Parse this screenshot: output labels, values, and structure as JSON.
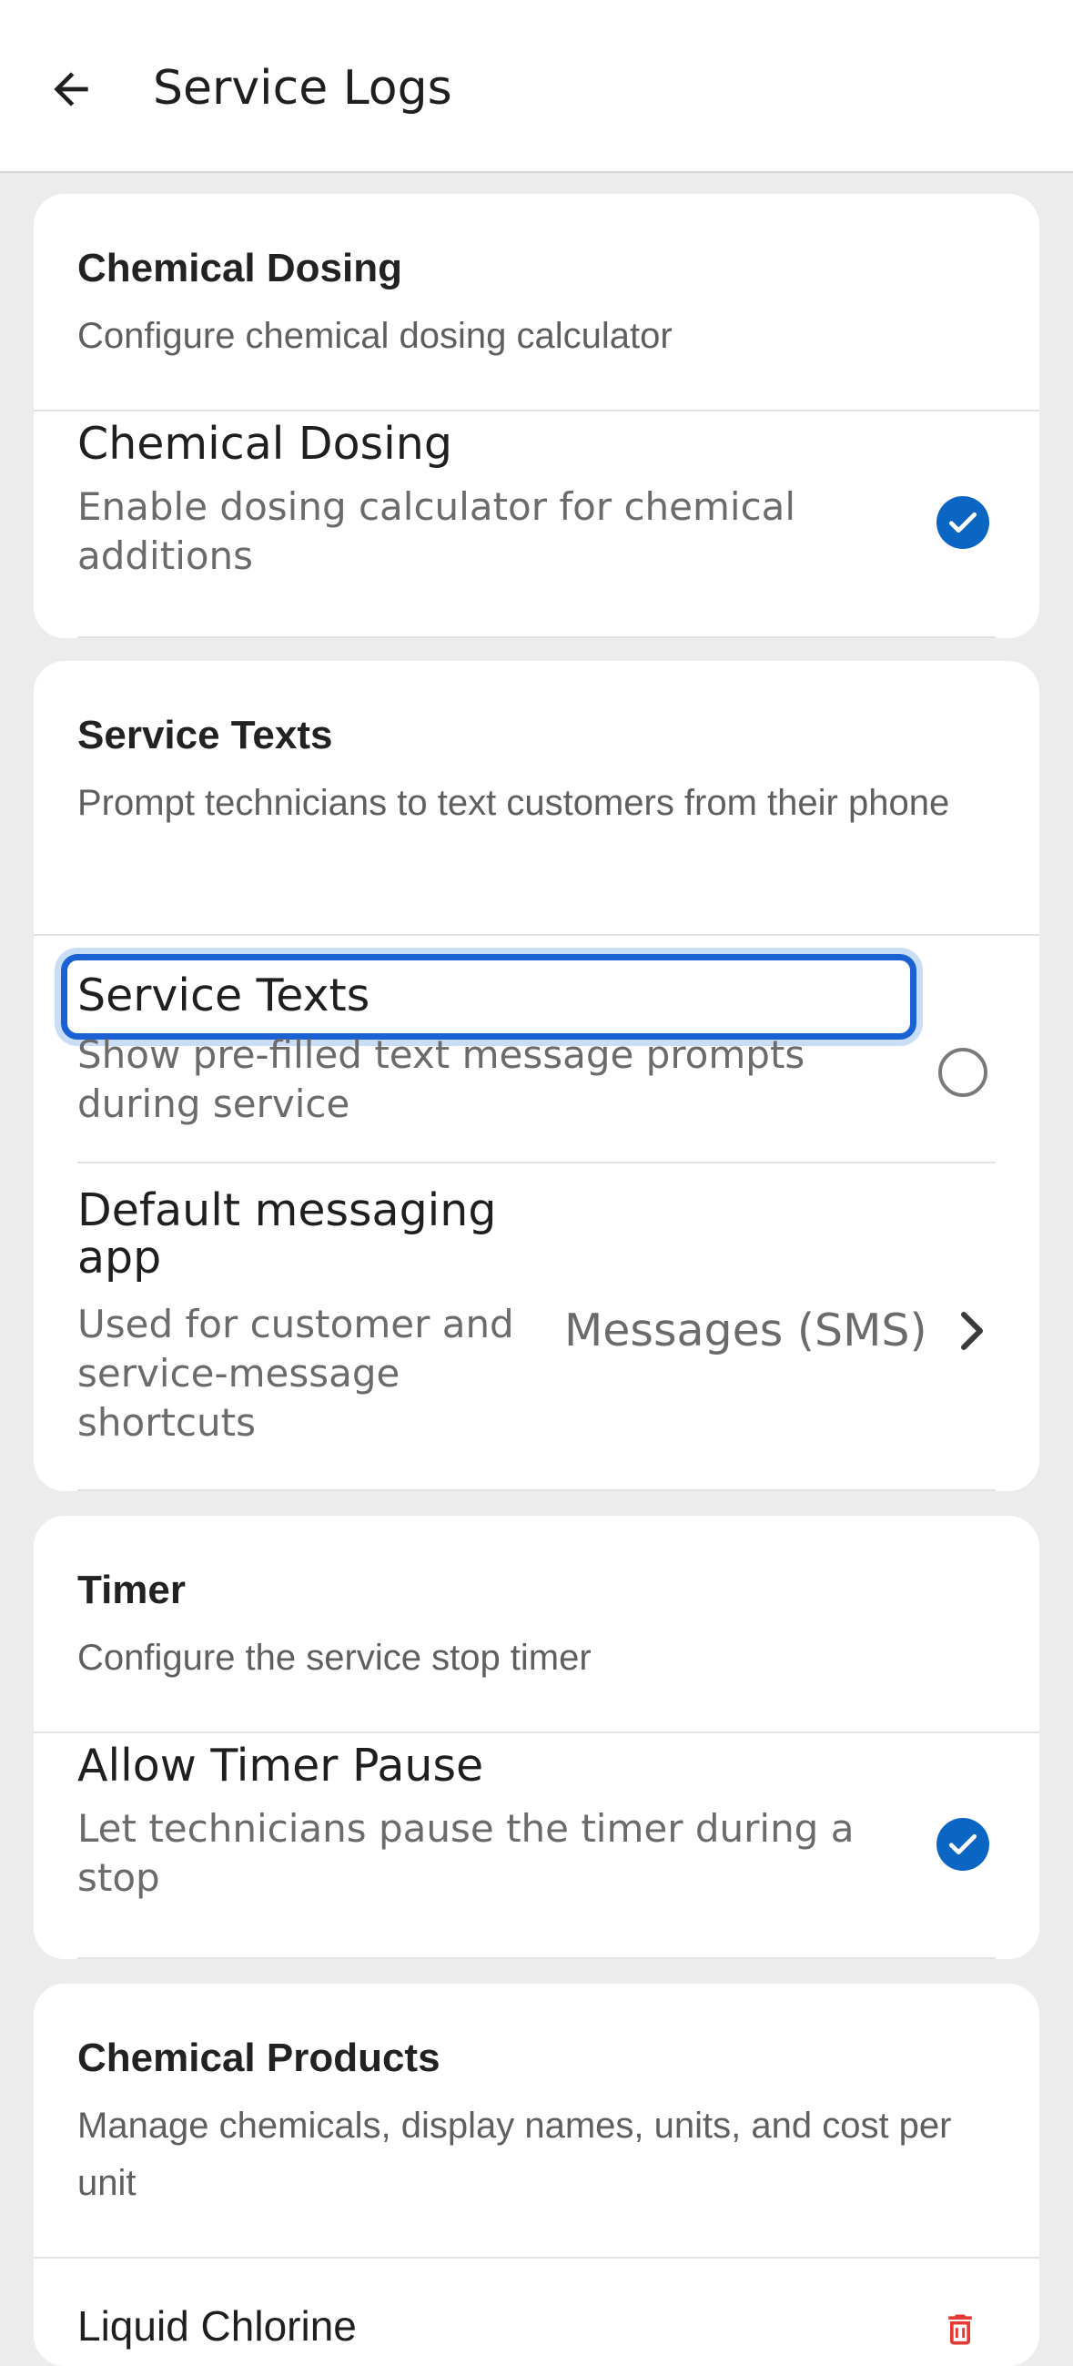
{
  "header": {
    "title": "Service Logs",
    "back_icon": "arrow-left-icon"
  },
  "sections": [
    {
      "title": "Chemical Dosing",
      "description": "Configure chemical dosing calculator",
      "rows": [
        {
          "title": "Chemical Dosing",
          "subtitle": "Enable dosing calculator for chemical additions",
          "checked": true
        }
      ]
    },
    {
      "title": "Service Texts",
      "description": "Prompt technicians to text customers from their phone",
      "rows": [
        {
          "title": "Service Texts",
          "subtitle": "Show pre-filled text message prompts during service",
          "checked": false,
          "focused": true
        },
        {
          "title": "Default messaging app",
          "subtitle": "Used for customer and service-message shortcuts",
          "value": "Messages (SMS)"
        }
      ]
    },
    {
      "title": "Timer",
      "description": "Configure the service stop timer",
      "rows": [
        {
          "title": "Allow Timer Pause",
          "subtitle": "Let technicians pause the timer during a stop",
          "checked": true
        }
      ]
    },
    {
      "title": "Chemical Products",
      "description": "Manage chemicals, display names, units, and cost per unit",
      "rows": [
        {
          "title": "Liquid Chlorine",
          "action_icon": "trash-icon"
        }
      ]
    }
  ],
  "colors": {
    "accent": "#0a66c2",
    "focus": "#1a62d4",
    "delete": "#e53935",
    "background": "#ececec"
  }
}
